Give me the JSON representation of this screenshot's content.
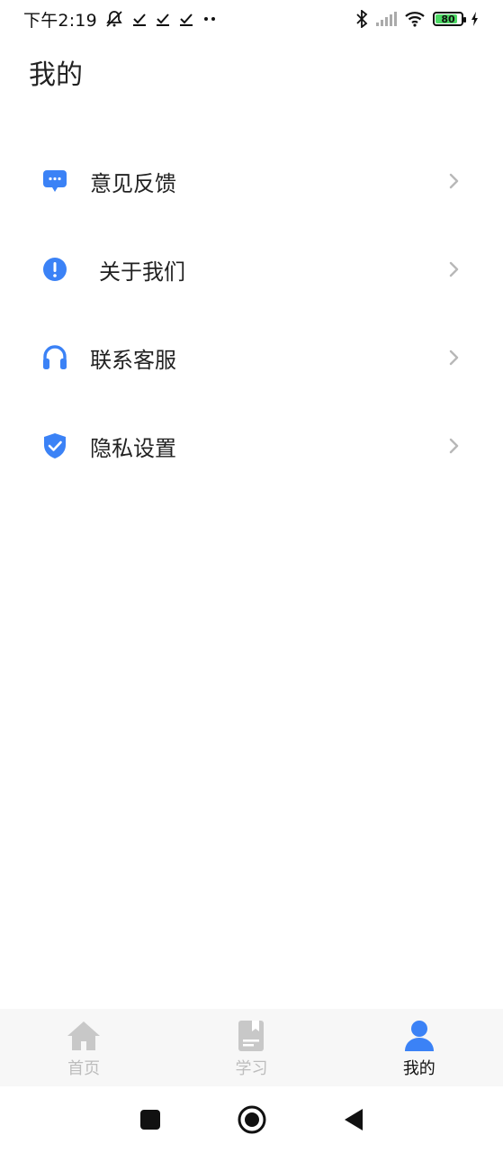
{
  "status_bar": {
    "time": "下午2:19",
    "battery": "80",
    "icons": [
      "mute-icon",
      "download-done-icon",
      "download-done-icon",
      "download-done-icon",
      "more-dots-icon",
      "bluetooth-icon",
      "signal-icon",
      "wifi-icon",
      "battery-icon",
      "charging-icon"
    ]
  },
  "page": {
    "title": "我的"
  },
  "menu": {
    "items": [
      {
        "label": "意见反馈",
        "icon": "feedback-chat-icon"
      },
      {
        "label": "关于我们",
        "icon": "info-exclamation-icon"
      },
      {
        "label": "联系客服",
        "icon": "headset-icon"
      },
      {
        "label": "隐私设置",
        "icon": "shield-check-icon"
      }
    ]
  },
  "bottom_nav": {
    "items": [
      {
        "label": "首页",
        "icon": "home-icon",
        "active": false
      },
      {
        "label": "学习",
        "icon": "book-icon",
        "active": false
      },
      {
        "label": "我的",
        "icon": "user-icon",
        "active": true
      }
    ]
  },
  "colors": {
    "accent": "#3b82f6",
    "inactive": "#c8c8c8",
    "text": "#222222",
    "chevron": "#b8b8b8",
    "nav_bg": "#f7f7f7",
    "battery_fill": "#4cd964"
  }
}
